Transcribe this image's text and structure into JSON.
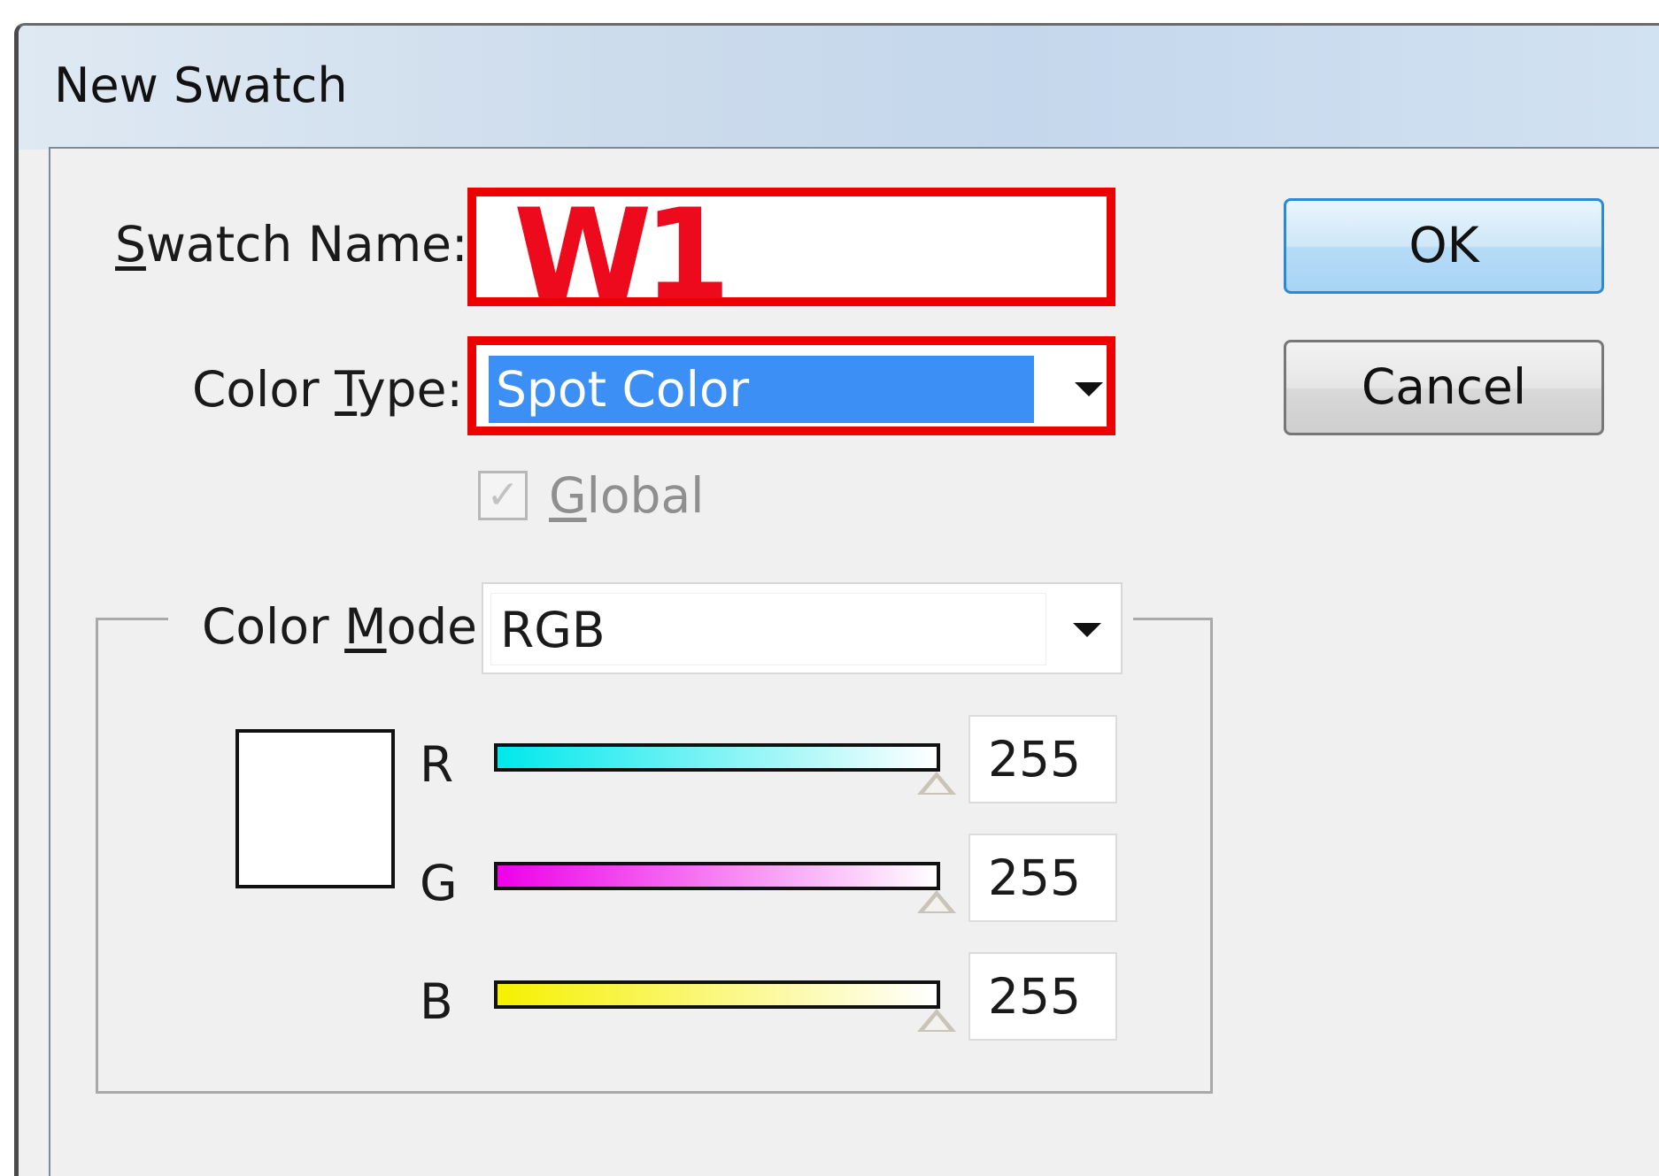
{
  "dialog": {
    "title": "New Swatch"
  },
  "swatch_name": {
    "label_first": "S",
    "label_rest": "watch Name:",
    "value": "W1"
  },
  "color_type": {
    "label_before": "Color ",
    "label_key": "T",
    "label_after": "ype:",
    "value": "Spot Color"
  },
  "global": {
    "label_key": "G",
    "label_rest": "lobal",
    "checked": true,
    "enabled": false
  },
  "color_mode": {
    "label_before": "Color ",
    "label_key": "M",
    "label_after": "ode:",
    "value": "RGB"
  },
  "channels": [
    {
      "label": "R",
      "value": "255",
      "gradient_from": "#00e8ec",
      "gradient_to": "#ffffff"
    },
    {
      "label": "G",
      "value": "255",
      "gradient_from": "#ee00e8",
      "gradient_to": "#ffffff"
    },
    {
      "label": "B",
      "value": "255",
      "gradient_from": "#f6f000",
      "gradient_to": "#ffffff"
    }
  ],
  "preview_color": "#ffffff",
  "buttons": {
    "ok": "OK",
    "cancel": "Cancel"
  },
  "colors": {
    "highlight": "#ec0000",
    "selection": "#3b8ff5",
    "ok_border": "#2f88d2"
  },
  "icons": [
    "dropdown-arrow-icon",
    "checkmark-icon",
    "slider-thumb-icon"
  ]
}
